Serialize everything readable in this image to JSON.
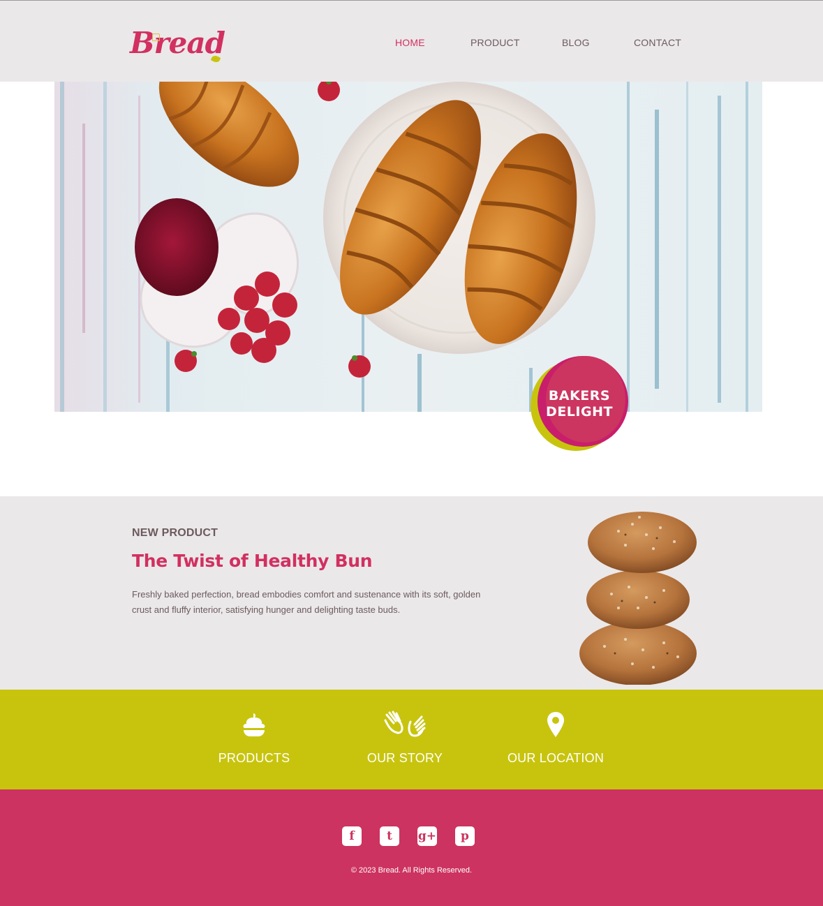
{
  "header": {
    "logo_text": "Bread",
    "nav": [
      {
        "label": "HOME",
        "active": true
      },
      {
        "label": "PRODUCT",
        "active": false
      },
      {
        "label": "BLOG",
        "active": false
      },
      {
        "label": "CONTACT",
        "active": false
      }
    ]
  },
  "hero": {
    "badge_line1": "BAKERS",
    "badge_line2": "DELIGHT"
  },
  "new_product": {
    "eyebrow": "NEW PRODUCT",
    "title": "The Twist of Healthy Bun",
    "description": "Freshly baked perfection, bread embodies comfort and sustenance with its soft, golden crust and fluffy interior, satisfying hunger and delighting taste buds."
  },
  "features": [
    {
      "label": "PRODUCTS",
      "icon": "cupcake-icon"
    },
    {
      "label": "OUR STORY",
      "icon": "hands-icon"
    },
    {
      "label": "OUR LOCATION",
      "icon": "location-pin-icon"
    }
  ],
  "footer": {
    "social": [
      {
        "icon": "facebook-icon",
        "glyph": "f"
      },
      {
        "icon": "twitter-icon",
        "glyph": "t"
      },
      {
        "icon": "google-plus-icon",
        "glyph": "g+"
      },
      {
        "icon": "pinterest-icon",
        "glyph": "p"
      }
    ],
    "copyright": "© 2023 Bread. All Rights Reserved."
  },
  "colors": {
    "brand_pink": "#d13060",
    "footer_pink": "#cc3360",
    "accent_lime": "#c8c40e",
    "header_gray": "#ebe8e9",
    "text_gray": "#6b5a5e"
  }
}
